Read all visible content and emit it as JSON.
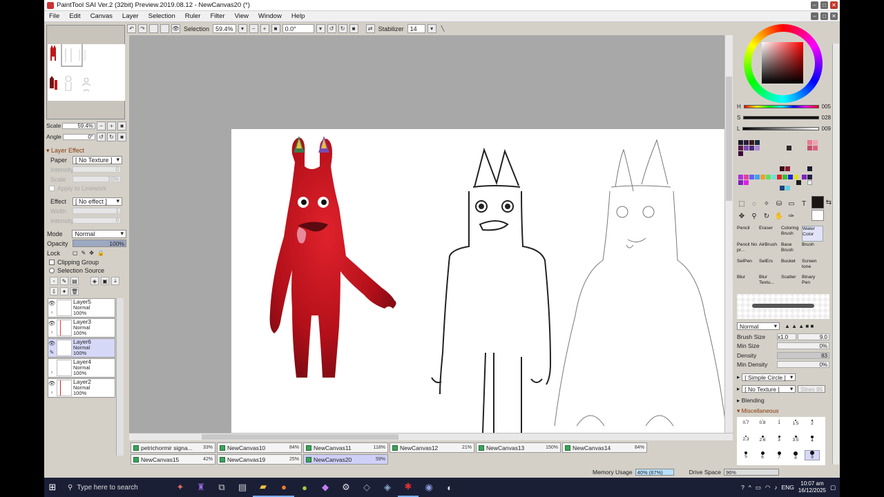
{
  "window": {
    "title": "PaintTool SAI Ver.2 (32bit) Preview.2019.08.12 - NewCanvas20 (*)"
  },
  "menu": [
    "File",
    "Edit",
    "Canvas",
    "Layer",
    "Selection",
    "Ruler",
    "Filter",
    "View",
    "Window",
    "Help"
  ],
  "toolbar": {
    "selection_label": "Selection",
    "zoom": "59.4%",
    "angle": "0.0°",
    "stabilizer_label": "Stabilizer",
    "stabilizer_value": "14"
  },
  "navigator": {
    "scale_label": "Scale",
    "scale_value": "59.4%",
    "angle_label": "Angle",
    "angle_value": "0°"
  },
  "layer_effect": {
    "title": "Layer Effect",
    "paper_label": "Paper",
    "paper_value": "[ No Texture ]",
    "intensity_label": "Intensity",
    "intensity_value": "0",
    "scale_label": "Scale",
    "scale_value": "10%",
    "apply_linework": "Apply to Linework",
    "effect_label": "Effect",
    "effect_value": "[ No effect ]",
    "width_label": "Width",
    "width_value": "1",
    "intensity2_label": "Intensity",
    "intensity2_value": "0"
  },
  "layer_props": {
    "mode_label": "Mode",
    "mode_value": "Normal",
    "opacity_label": "Opacity",
    "opacity_value": "100%",
    "lock_label": "Lock",
    "clipping_group": "Clipping Group",
    "selection_source": "Selection Source"
  },
  "layers": [
    {
      "name": "Layer5",
      "mode": "Normal",
      "opacity": "100%",
      "active": false
    },
    {
      "name": "Layer3",
      "mode": "Normal",
      "opacity": "100%",
      "active": false
    },
    {
      "name": "Layer6",
      "mode": "Normal",
      "opacity": "100%",
      "active": true
    },
    {
      "name": "Layer4",
      "mode": "Normal",
      "opacity": "100%",
      "active": false
    },
    {
      "name": "Layer2",
      "mode": "Normal",
      "opacity": "100%",
      "active": false
    }
  ],
  "doc_tabs": [
    {
      "name": "petrichormir signa...",
      "percent": "33%",
      "active": false
    },
    {
      "name": "NewCanvas10",
      "percent": "84%",
      "active": false
    },
    {
      "name": "NewCanvas11",
      "percent": "118%",
      "active": false
    },
    {
      "name": "NewCanvas12",
      "percent": "21%",
      "active": false
    },
    {
      "name": "NewCanvas13",
      "percent": "150%",
      "active": false
    },
    {
      "name": "NewCanvas14",
      "percent": "84%",
      "active": false
    },
    {
      "name": "NewCanvas15",
      "percent": "42%",
      "active": false
    },
    {
      "name": "NewCanvas19",
      "percent": "25%",
      "active": false
    },
    {
      "name": "NewCanvas20",
      "percent": "59%",
      "active": true
    }
  ],
  "status": {
    "memory_label": "Memory Usage",
    "memory_value": "40% (67%)",
    "memory_fraction": 0.4,
    "drive_label": "Drive Space",
    "drive_value": "96%",
    "drive_fraction": 0.96
  },
  "color": {
    "h_label": "H",
    "h_value": "005",
    "s_label": "S",
    "s_value": "028",
    "l_label": "L",
    "l_value": "009",
    "current": "#1a1412"
  },
  "brushes": [
    [
      "Pencil",
      "Eraser",
      "Coloring Brush",
      "Water Color"
    ],
    [
      "Pencil No pr...",
      "AirBrush",
      "Base Brush",
      "Brush"
    ],
    [
      "SelPen",
      "SelErs",
      "Bucket",
      "Screen tone"
    ],
    [
      "Blur",
      "Blur Textu...",
      "Scatter",
      "Binary Pen"
    ]
  ],
  "brush_props": {
    "blend_mode": "Normal",
    "size_label": "Brush Size",
    "size_mult": "x1.0",
    "size_value": "9.0",
    "min_size_label": "Min Size",
    "min_size_value": "0%",
    "density_label": "Density",
    "density_value": "83",
    "min_density_label": "Min Density",
    "min_density_value": "0%",
    "shape": "[ Simple Circle ]",
    "texture": "[ No Texture ]",
    "texture_strength": "Stren",
    "texture_strength_value": "95",
    "blending_label": "Blending",
    "misc_label": "Miscellaneous"
  },
  "brush_sizes": [
    [
      "0.7",
      "0.8",
      "1",
      "1.5",
      "2"
    ],
    [
      "2.3",
      "2.6",
      "3",
      "3.5",
      "4"
    ],
    [
      "5",
      "6",
      "7",
      "8",
      "9"
    ]
  ],
  "taskbar": {
    "search_placeholder": "Type here to search",
    "lang": "ENG",
    "time": "10:07 am",
    "date": "16/12/2025"
  }
}
